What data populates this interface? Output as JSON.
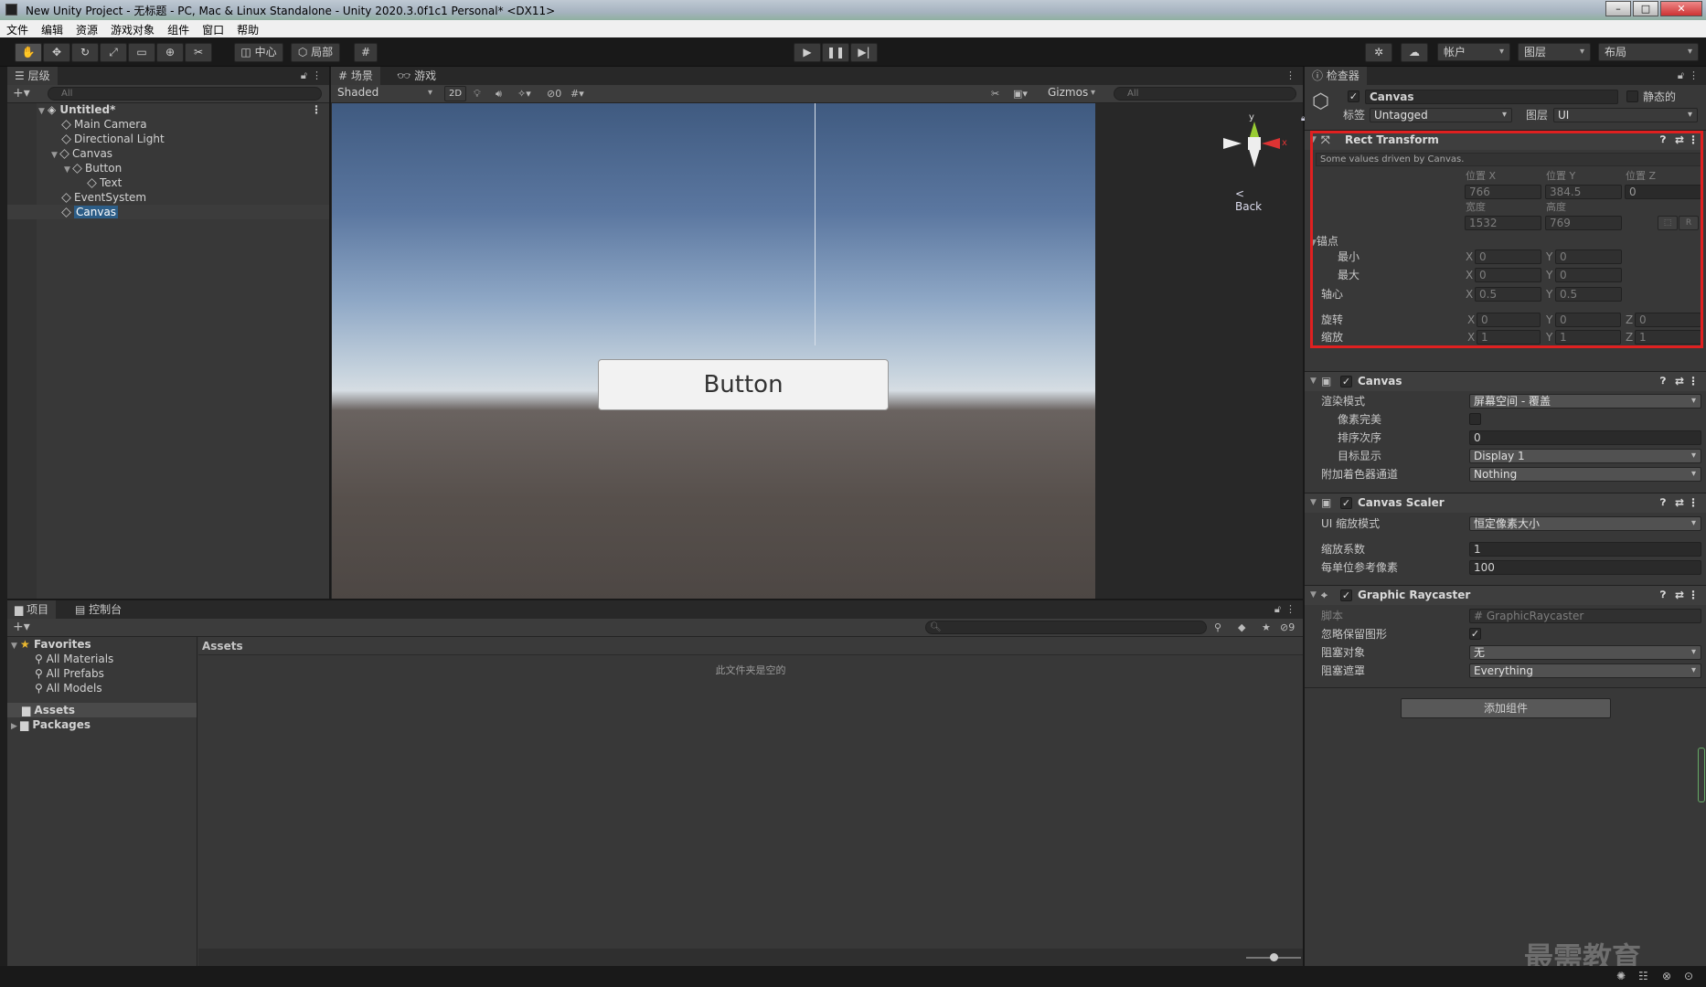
{
  "window": {
    "title": "New Unity Project - 无标题 - PC, Mac & Linux Standalone - Unity 2020.3.0f1c1 Personal* <DX11>"
  },
  "menu": [
    "文件",
    "编辑",
    "资源",
    "游戏对象",
    "组件",
    "窗口",
    "帮助"
  ],
  "toolbar": {
    "pivot": "中心",
    "space": "局部",
    "account": "帐户",
    "layers": "图层",
    "layout": "布局"
  },
  "hierarchy": {
    "tab": "层级",
    "search_placeholder": "All",
    "scene_name": "Untitled*",
    "items": [
      {
        "label": "Main Camera"
      },
      {
        "label": "Directional Light"
      },
      {
        "label": "Canvas"
      },
      {
        "label": "Button"
      },
      {
        "label": "Text"
      },
      {
        "label": "EventSystem"
      },
      {
        "label": "Canvas"
      }
    ]
  },
  "scene_view": {
    "tab_scene": "场景",
    "tab_game": "游戏",
    "shading": "Shaded",
    "mode_2d": "2D",
    "hidden_count": "0",
    "gizmos": "Gizmos",
    "search_placeholder": "All",
    "back_label": "< Back",
    "button_text": "Button",
    "axis_y": "y",
    "axis_x": "x"
  },
  "project": {
    "tab_project": "项目",
    "tab_console": "控制台",
    "favorites_label": "Favorites",
    "favorites": [
      "All Materials",
      "All Prefabs",
      "All Models"
    ],
    "folders": [
      "Assets",
      "Packages"
    ],
    "breadcrumb": "Assets",
    "empty_message": "此文件夹是空的",
    "hidden_count": "9"
  },
  "inspector": {
    "tab": "检查器",
    "object_name": "Canvas",
    "static_label": "静态的",
    "tag_label": "标签",
    "tag_value": "Untagged",
    "layer_label": "图层",
    "layer_value": "UI",
    "rect_transform": {
      "title": "Rect Transform",
      "note": "Some values driven by Canvas.",
      "pos_x_label": "位置 X",
      "pos_y_label": "位置 Y",
      "pos_z_label": "位置 Z",
      "pos_x": "766",
      "pos_y": "384.5",
      "pos_z": "0",
      "width_label": "宽度",
      "height_label": "高度",
      "width": "1532",
      "height": "769",
      "r_btn": "R",
      "anchors_label": "锚点",
      "min_label": "最小",
      "max_label": "最大",
      "min_x": "0",
      "min_y": "0",
      "max_x": "0",
      "max_y": "0",
      "pivot_label": "轴心",
      "pivot_x": "0.5",
      "pivot_y": "0.5",
      "rotation_label": "旋转",
      "rot_x": "0",
      "rot_y": "0",
      "rot_z": "0",
      "scale_label": "缩放",
      "scale_x": "1",
      "scale_y": "1",
      "scale_z": "1"
    },
    "canvas": {
      "title": "Canvas",
      "render_mode_label": "渲染模式",
      "render_mode": "屏幕空间 - 覆盖",
      "pixel_perfect_label": "像素完美",
      "sort_order_label": "排序次序",
      "sort_order": "0",
      "target_display_label": "目标显示",
      "target_display": "Display 1",
      "shader_channels_label": "附加着色器通道",
      "shader_channels": "Nothing"
    },
    "canvas_scaler": {
      "title": "Canvas Scaler",
      "scale_mode_label": "UI 缩放模式",
      "scale_mode": "恒定像素大小",
      "scale_factor_label": "缩放系数",
      "scale_factor": "1",
      "ref_ppu_label": "每单位参考像素",
      "ref_ppu": "100"
    },
    "graphic_raycaster": {
      "title": "Graphic Raycaster",
      "script_label": "脚本",
      "script_value": "GraphicRaycaster",
      "ignore_reversed_label": "忽略保留图形",
      "blocking_objects_label": "阻塞对象",
      "blocking_objects": "无",
      "blocking_mask_label": "阻塞遮罩",
      "blocking_mask": "Everything"
    },
    "add_component": "添加组件"
  },
  "axis_letters": {
    "x": "X",
    "y": "Y",
    "z": "Z"
  },
  "watermark": "最需教育",
  "colors": {
    "highlight_red": "#e02020",
    "selection_blue": "#2c5d87"
  }
}
